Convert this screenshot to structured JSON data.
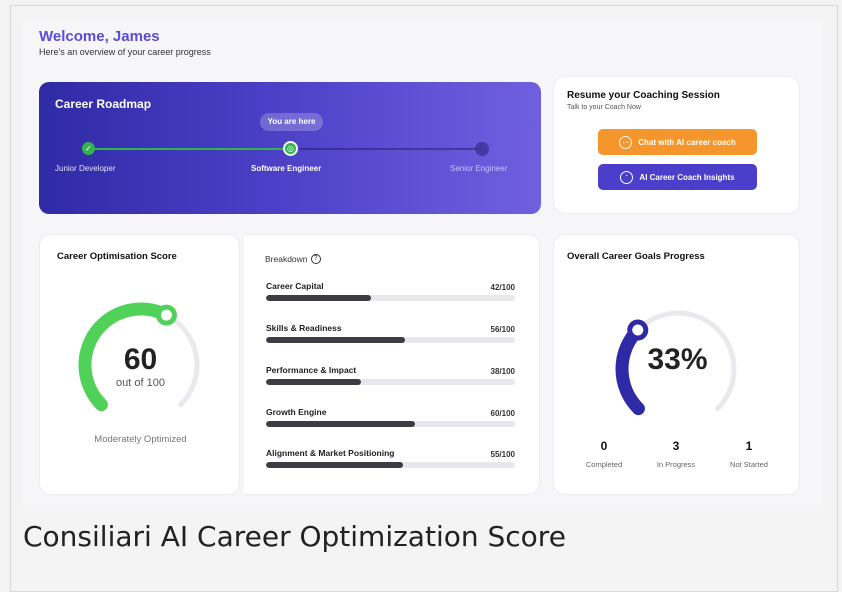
{
  "header": {
    "welcome": "Welcome, James",
    "subtitle": "Here's an overview of your career progress"
  },
  "roadmap": {
    "title": "Career Roadmap",
    "marker": "You are here",
    "steps": [
      {
        "label": "Junior Developer",
        "status": "completed"
      },
      {
        "label": "Software Engineer",
        "status": "current"
      },
      {
        "label": "Senior Engineer",
        "status": "upcoming"
      }
    ]
  },
  "coaching": {
    "title": "Resume your Coaching Session",
    "subtitle": "Talk to your Coach Now",
    "chat_button": "Chat with AI career coach",
    "insights_button": "AI Career Coach Insights",
    "chat_icon": "chat-bubble-icon",
    "insights_icon": "coach-insights-icon"
  },
  "optimisation": {
    "title": "Career Optimisation Score",
    "score": "60",
    "out_of": "out of 100",
    "status": "Moderately Optimized",
    "fraction": 0.6,
    "color": "#4fd15a"
  },
  "breakdown": {
    "title": "Breakdown",
    "help_icon": "question-circle-icon",
    "items": [
      {
        "label": "Career Capital",
        "display": "42/100",
        "value": 42
      },
      {
        "label": "Skills & Readiness",
        "display": "56/100",
        "value": 56
      },
      {
        "label": "Performance & Impact",
        "display": "38/100",
        "value": 38
      },
      {
        "label": "Growth Engine",
        "display": "60/100",
        "value": 60
      },
      {
        "label": "Alignment & Market Positioning",
        "display": "55/100",
        "value": 55
      }
    ]
  },
  "goals": {
    "title": "Overall Career Goals Progress",
    "percent": "33%",
    "fraction": 0.33,
    "color": "#2e2aa5",
    "stats": [
      {
        "value": "0",
        "label": "Completed"
      },
      {
        "value": "3",
        "label": "In Progress"
      },
      {
        "value": "1",
        "label": "Not Started"
      }
    ]
  },
  "caption": "Consiliari AI Career Optimization Score"
}
